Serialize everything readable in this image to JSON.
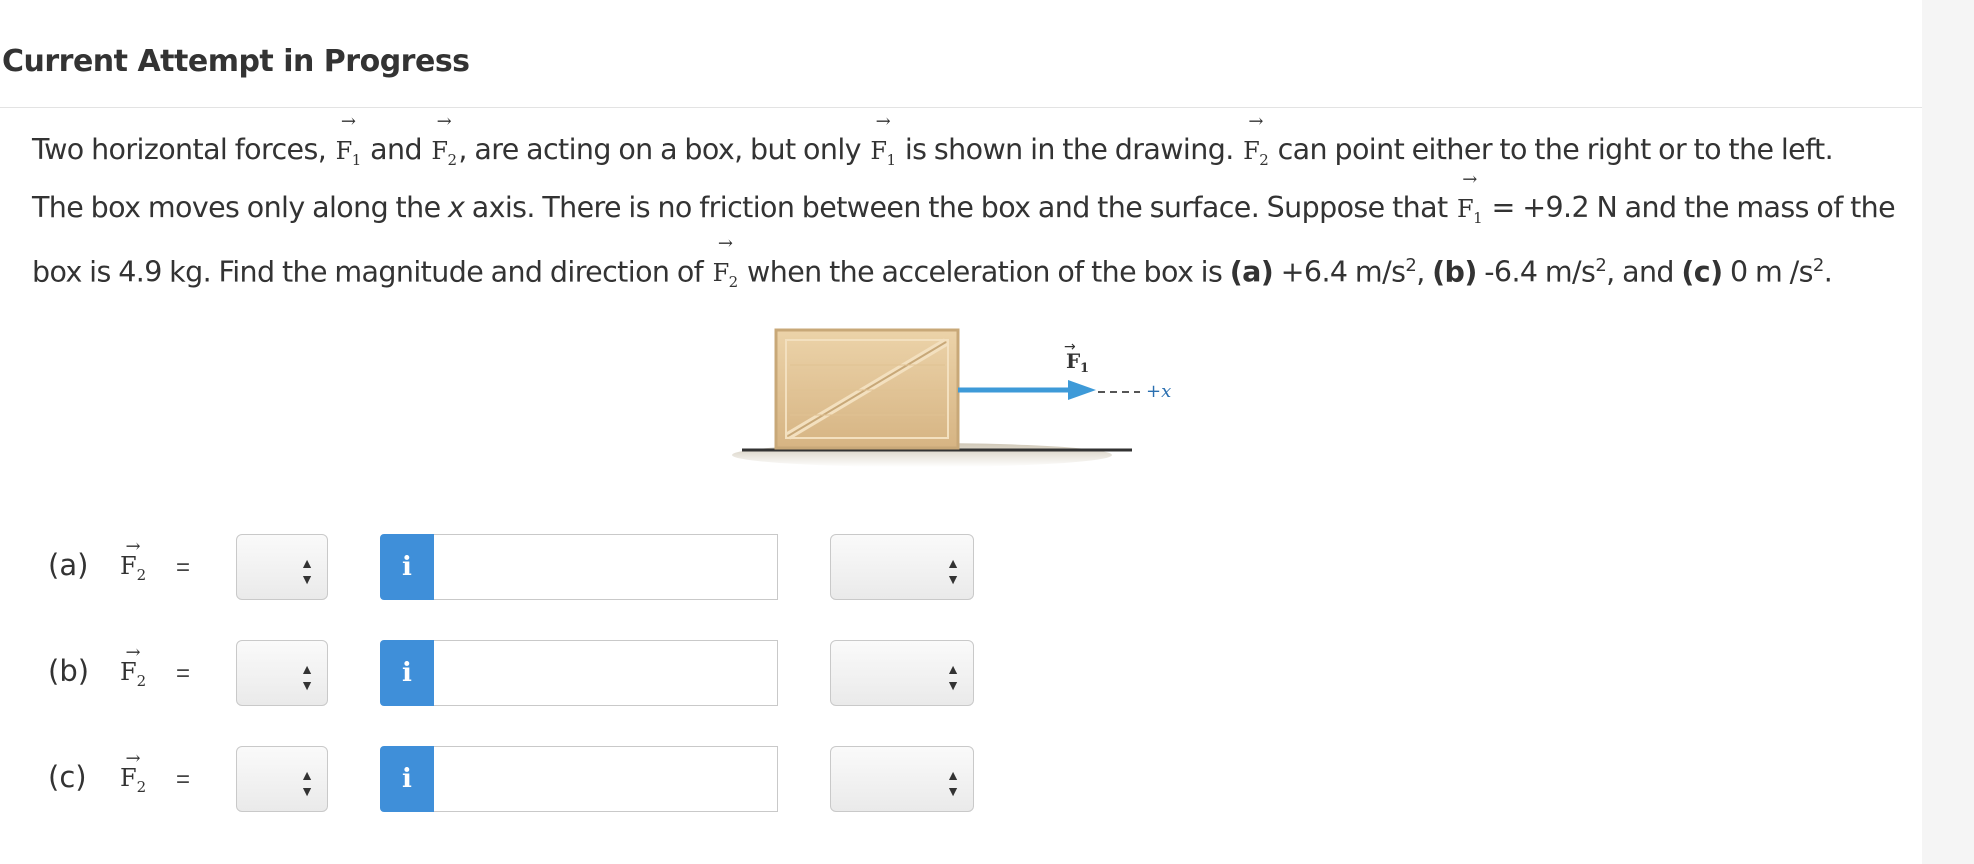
{
  "header": {
    "title": "Current Attempt in Progress"
  },
  "question": {
    "line1": {
      "t1": "Two horizontal forces, ",
      "t2": " and ",
      "t3": ", are acting on a box, but only ",
      "t4": " is shown in the drawing. ",
      "t5": " can point either to the right or to the left."
    },
    "line2": {
      "t1": "The box moves only along the ",
      "x": "x",
      "t2": " axis. There is no friction between the box and the surface. Suppose that ",
      "t3": " = +9.2 N and the mass of the"
    },
    "line3": {
      "t1": "box is 4.9  kg. Find the magnitude and direction of ",
      "t2": " when the acceleration of the box is ",
      "a": "(a)",
      "t3": " +6.4 m/s",
      "t4": ", ",
      "b": "(b)",
      "t5": " -6.4 m/s",
      "t6": ", and ",
      "c": "(c)",
      "t7": " 0 m /s",
      "t8": "."
    },
    "exp": "2",
    "F": "F",
    "sub1": "1",
    "sub2": "2",
    "arrow": "→"
  },
  "figure": {
    "force_label": "F",
    "force_sub": "1",
    "axis_label": "+x",
    "colors": {
      "box": "#e3c79b",
      "arrow": "#3e9ad8",
      "ground": "#333333"
    }
  },
  "answers": [
    {
      "part": "(a)",
      "eq": "=",
      "info": "i",
      "value": ""
    },
    {
      "part": "(b)",
      "eq": "=",
      "info": "i",
      "value": ""
    },
    {
      "part": "(c)",
      "eq": "=",
      "info": "i",
      "value": ""
    }
  ],
  "select_caret": "▲▼",
  "colors": {
    "info_button": "#3f8fd9",
    "border": "#c9c9c9",
    "header_rule": "#e3e3e3"
  }
}
